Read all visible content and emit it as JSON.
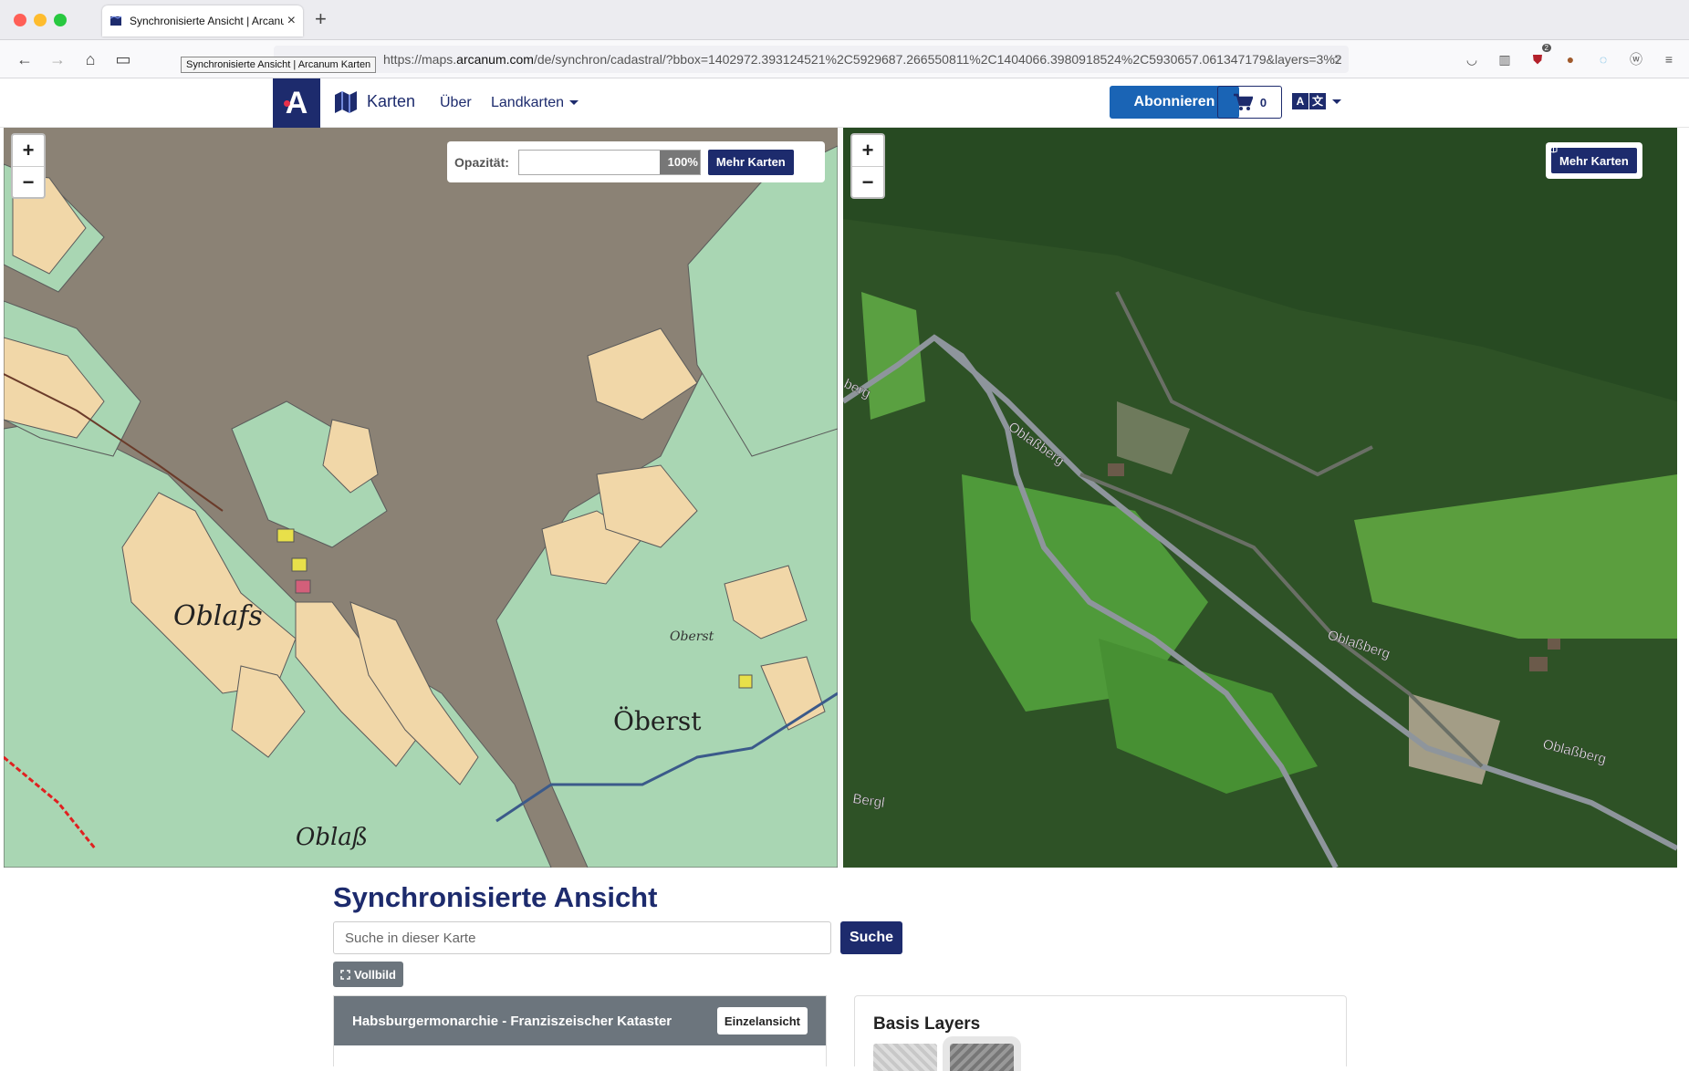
{
  "browser": {
    "tab_title": "Synchronisierte Ansicht | Arcanum Karten",
    "url_prefix": "https://maps.",
    "url_domain": "arcanum.com",
    "url_path": "/de/synchron/cadastral/?bbox=1402972.393124521%2C5929687.266550811%2C1404066.3980918524%2C5930657.061347179&layers=3%2",
    "tooltip": "Synchronisierte Ansicht | Arcanum Karten",
    "extension_badge": "2"
  },
  "nav": {
    "brand": "Karten",
    "links": [
      "Über",
      "Landkarten"
    ],
    "subscribe": "Abonnieren",
    "cart_count": "0",
    "lang": [
      "A",
      "文"
    ]
  },
  "map_left": {
    "opacity_label": "Opazität:",
    "opacity_value": "100%",
    "opacity_level": 1.0,
    "more_maps": "Mehr Karten",
    "labels": [
      "Oblafs",
      "Öberst",
      "Oblaß",
      "Oberst"
    ]
  },
  "map_right": {
    "more_maps": "Mehr Karten",
    "labels": [
      "Oblaßberg",
      "Oblaßberg",
      "Oblaßberg",
      "Bergl",
      "berg"
    ]
  },
  "zoom": {
    "in": "+",
    "out": "−"
  },
  "content": {
    "title": "Synchronisierte Ansicht",
    "search_placeholder": "Suche in dieser Karte",
    "search_button": "Suche",
    "fullscreen": "Vollbild",
    "panel_title": "Habsburgermonarchie - Franziszeischer Kataster",
    "single_view": "Einzelansicht",
    "base_layers": "Basis Layers"
  }
}
